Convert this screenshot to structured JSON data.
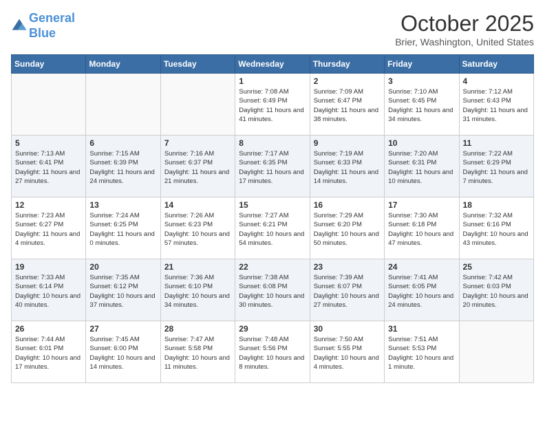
{
  "header": {
    "logo_line1": "General",
    "logo_line2": "Blue",
    "month_title": "October 2025",
    "location": "Brier, Washington, United States"
  },
  "weekdays": [
    "Sunday",
    "Monday",
    "Tuesday",
    "Wednesday",
    "Thursday",
    "Friday",
    "Saturday"
  ],
  "weeks": [
    [
      {
        "day": "",
        "info": ""
      },
      {
        "day": "",
        "info": ""
      },
      {
        "day": "",
        "info": ""
      },
      {
        "day": "1",
        "info": "Sunrise: 7:08 AM\nSunset: 6:49 PM\nDaylight: 11 hours and 41 minutes."
      },
      {
        "day": "2",
        "info": "Sunrise: 7:09 AM\nSunset: 6:47 PM\nDaylight: 11 hours and 38 minutes."
      },
      {
        "day": "3",
        "info": "Sunrise: 7:10 AM\nSunset: 6:45 PM\nDaylight: 11 hours and 34 minutes."
      },
      {
        "day": "4",
        "info": "Sunrise: 7:12 AM\nSunset: 6:43 PM\nDaylight: 11 hours and 31 minutes."
      }
    ],
    [
      {
        "day": "5",
        "info": "Sunrise: 7:13 AM\nSunset: 6:41 PM\nDaylight: 11 hours and 27 minutes."
      },
      {
        "day": "6",
        "info": "Sunrise: 7:15 AM\nSunset: 6:39 PM\nDaylight: 11 hours and 24 minutes."
      },
      {
        "day": "7",
        "info": "Sunrise: 7:16 AM\nSunset: 6:37 PM\nDaylight: 11 hours and 21 minutes."
      },
      {
        "day": "8",
        "info": "Sunrise: 7:17 AM\nSunset: 6:35 PM\nDaylight: 11 hours and 17 minutes."
      },
      {
        "day": "9",
        "info": "Sunrise: 7:19 AM\nSunset: 6:33 PM\nDaylight: 11 hours and 14 minutes."
      },
      {
        "day": "10",
        "info": "Sunrise: 7:20 AM\nSunset: 6:31 PM\nDaylight: 11 hours and 10 minutes."
      },
      {
        "day": "11",
        "info": "Sunrise: 7:22 AM\nSunset: 6:29 PM\nDaylight: 11 hours and 7 minutes."
      }
    ],
    [
      {
        "day": "12",
        "info": "Sunrise: 7:23 AM\nSunset: 6:27 PM\nDaylight: 11 hours and 4 minutes."
      },
      {
        "day": "13",
        "info": "Sunrise: 7:24 AM\nSunset: 6:25 PM\nDaylight: 11 hours and 0 minutes."
      },
      {
        "day": "14",
        "info": "Sunrise: 7:26 AM\nSunset: 6:23 PM\nDaylight: 10 hours and 57 minutes."
      },
      {
        "day": "15",
        "info": "Sunrise: 7:27 AM\nSunset: 6:21 PM\nDaylight: 10 hours and 54 minutes."
      },
      {
        "day": "16",
        "info": "Sunrise: 7:29 AM\nSunset: 6:20 PM\nDaylight: 10 hours and 50 minutes."
      },
      {
        "day": "17",
        "info": "Sunrise: 7:30 AM\nSunset: 6:18 PM\nDaylight: 10 hours and 47 minutes."
      },
      {
        "day": "18",
        "info": "Sunrise: 7:32 AM\nSunset: 6:16 PM\nDaylight: 10 hours and 43 minutes."
      }
    ],
    [
      {
        "day": "19",
        "info": "Sunrise: 7:33 AM\nSunset: 6:14 PM\nDaylight: 10 hours and 40 minutes."
      },
      {
        "day": "20",
        "info": "Sunrise: 7:35 AM\nSunset: 6:12 PM\nDaylight: 10 hours and 37 minutes."
      },
      {
        "day": "21",
        "info": "Sunrise: 7:36 AM\nSunset: 6:10 PM\nDaylight: 10 hours and 34 minutes."
      },
      {
        "day": "22",
        "info": "Sunrise: 7:38 AM\nSunset: 6:08 PM\nDaylight: 10 hours and 30 minutes."
      },
      {
        "day": "23",
        "info": "Sunrise: 7:39 AM\nSunset: 6:07 PM\nDaylight: 10 hours and 27 minutes."
      },
      {
        "day": "24",
        "info": "Sunrise: 7:41 AM\nSunset: 6:05 PM\nDaylight: 10 hours and 24 minutes."
      },
      {
        "day": "25",
        "info": "Sunrise: 7:42 AM\nSunset: 6:03 PM\nDaylight: 10 hours and 20 minutes."
      }
    ],
    [
      {
        "day": "26",
        "info": "Sunrise: 7:44 AM\nSunset: 6:01 PM\nDaylight: 10 hours and 17 minutes."
      },
      {
        "day": "27",
        "info": "Sunrise: 7:45 AM\nSunset: 6:00 PM\nDaylight: 10 hours and 14 minutes."
      },
      {
        "day": "28",
        "info": "Sunrise: 7:47 AM\nSunset: 5:58 PM\nDaylight: 10 hours and 11 minutes."
      },
      {
        "day": "29",
        "info": "Sunrise: 7:48 AM\nSunset: 5:56 PM\nDaylight: 10 hours and 8 minutes."
      },
      {
        "day": "30",
        "info": "Sunrise: 7:50 AM\nSunset: 5:55 PM\nDaylight: 10 hours and 4 minutes."
      },
      {
        "day": "31",
        "info": "Sunrise: 7:51 AM\nSunset: 5:53 PM\nDaylight: 10 hours and 1 minute."
      },
      {
        "day": "",
        "info": ""
      }
    ]
  ]
}
